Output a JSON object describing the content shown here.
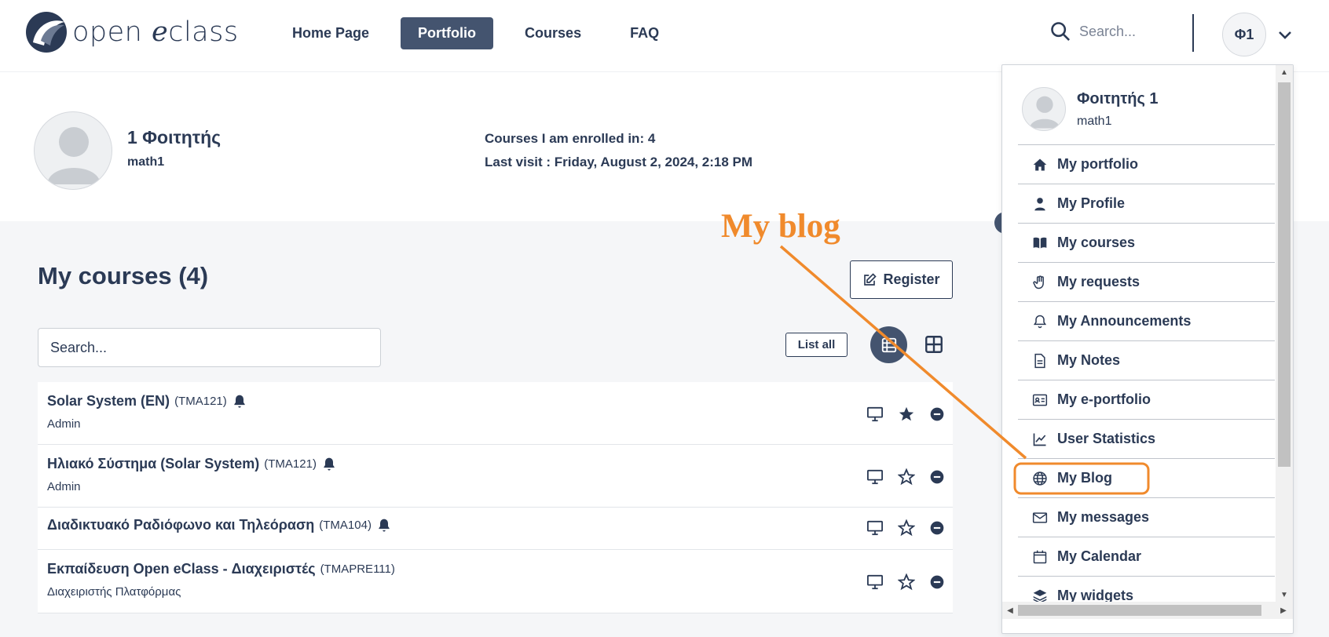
{
  "brand": {
    "name_part1": "open ",
    "name_part2": "e",
    "name_part3": "class"
  },
  "nav": [
    {
      "label": "Home Page",
      "active": false
    },
    {
      "label": "Portfolio",
      "active": true
    },
    {
      "label": "Courses",
      "active": false
    },
    {
      "label": "FAQ",
      "active": false
    }
  ],
  "top_search": {
    "placeholder": "Search..."
  },
  "user_badge": "Φ1",
  "profile": {
    "name": "1 Φοιτητής",
    "username": "math1",
    "enrolled": "Courses I am enrolled in: 4",
    "last_visit": "Last visit : Friday, August 2, 2024, 2:18 PM"
  },
  "courses": {
    "title": "My courses  (4)",
    "register_label": "Register",
    "search_placeholder": "Search...",
    "list_all_label": "List all",
    "rows": [
      {
        "title": "Solar System (EN)",
        "code": "(TMA121)",
        "bell": true,
        "subtitle": "Admin",
        "favorite": true
      },
      {
        "title": "Ηλιακό Σύστημα (Solar System)",
        "code": "(TMA121)",
        "bell": true,
        "subtitle": "Admin",
        "favorite": false
      },
      {
        "title": "Διαδικτυακό Ραδιόφωνο και Τηλεόραση",
        "code": "(TMA104)",
        "bell": true,
        "subtitle": "",
        "favorite": false
      },
      {
        "title": "Εκπαίδευση Open eClass - Διαχειριστές",
        "code": "(TMAPRE111)",
        "bell": false,
        "subtitle": "Διαχειριστής Πλατφόρμας",
        "favorite": false
      }
    ]
  },
  "user_menu": {
    "name": "Φοιτητής 1",
    "username": "math1",
    "items": [
      {
        "label": "My portfolio",
        "icon": "home-icon"
      },
      {
        "label": "My Profile",
        "icon": "user-icon"
      },
      {
        "label": "My courses",
        "icon": "book-icon"
      },
      {
        "label": "My requests",
        "icon": "hand-icon"
      },
      {
        "label": "My Announcements",
        "icon": "bell-icon"
      },
      {
        "label": "My Notes",
        "icon": "note-icon"
      },
      {
        "label": "My e-portfolio",
        "icon": "id-card-icon"
      },
      {
        "label": "User Statistics",
        "icon": "chart-icon"
      },
      {
        "label": "My Blog",
        "icon": "globe-icon"
      },
      {
        "label": "My messages",
        "icon": "envelope-icon"
      },
      {
        "label": "My Calendar",
        "icon": "calendar-icon"
      },
      {
        "label": "My widgets",
        "icon": "layers-icon"
      }
    ]
  },
  "annotation": {
    "label": "My blog",
    "color": "#f08a2c"
  },
  "colors": {
    "primary": "#44546f",
    "text": "#2b3a55",
    "annotation": "#f08a2c"
  }
}
